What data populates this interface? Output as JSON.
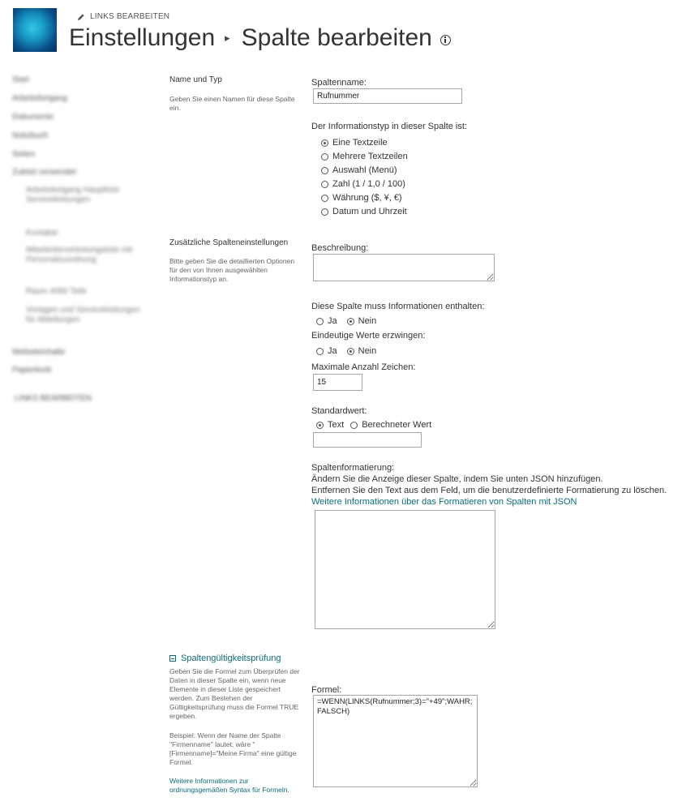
{
  "header": {
    "edit_links": "LINKS BEARBEITEN",
    "title_part1": "Einstellungen",
    "title_separator": "▸",
    "title_part2": "Spalte bearbeiten"
  },
  "nav": {
    "items": [
      "Start",
      "Arbeitsfortgang",
      "Dokumente",
      "Notizbuch",
      "Seiten",
      "Zuletzt verwendet",
      "Arbeitsfortgang Hauptliste Serviceleistungen",
      "Kontakte",
      "Mitarbeitervertretungsliste mit Personalzuordnung",
      "Raum 4050 Teile",
      "Vorlagen und Serviceleistungen für Abteilungen",
      "Websiteinhalte",
      "Papierkorb",
      "LINKS BEARBEITEN"
    ]
  },
  "section_name_type": {
    "title": "Name und Typ",
    "desc": "Geben Sie einen Namen für diese Spalte ein.",
    "column_name_label": "Spaltenname:",
    "column_name_value": "Rufnummer",
    "info_type_label": "Der Informationstyp in dieser Spalte ist:",
    "types": [
      "Eine Textzeile",
      "Mehrere Textzeilen",
      "Auswahl (Menü)",
      "Zahl (1 / 1,0 / 100)",
      "Währung ($, ¥, €)",
      "Datum und Uhrzeit"
    ],
    "selected_type": "Eine Textzeile"
  },
  "section_additional": {
    "title": "Zusätzliche Spalteneinstellungen",
    "desc": "Bitte geben Sie die detaillierten Optionen für den von Ihnen ausgewählten Informationstyp an.",
    "description_label": "Beschreibung:",
    "description_value": "",
    "required_label": "Diese Spalte muss Informationen enthalten:",
    "unique_label": "Eindeutige Werte erzwingen:",
    "yes": "Ja",
    "no": "Nein",
    "required_value": "Nein",
    "unique_value": "Nein",
    "max_chars_label": "Maximale Anzahl Zeichen:",
    "max_chars_value": "15",
    "default_label": "Standardwert:",
    "default_option_text": "Text",
    "default_option_calc": "Berechneter Wert",
    "default_selected": "Text",
    "default_value": "",
    "formatting_label": "Spaltenformatierung:",
    "formatting_line1": "Ändern Sie die Anzeige dieser Spalte, indem Sie unten JSON hinzufügen.",
    "formatting_line2": "Entfernen Sie den Text aus dem Feld, um die benutzerdefinierte Formatierung zu löschen.",
    "formatting_link": "Weitere Informationen über das Formatieren von Spalten mit JSON",
    "formatting_value": ""
  },
  "section_validation": {
    "title": "Spaltengültigkeitsprüfung",
    "desc1": "Geben Sie die Formel zum Überprüfen der Daten in dieser Spalte ein, wenn neue Elemente in dieser Liste gespeichert werden. Zum Bestehen der Gültigkeitsprüfung muss die Formel TRUE ergeben.",
    "desc2": "Beispiel: Wenn der Name der Spalte \"Firmenname\" lautet, wäre \"[Firmenname]=\"Meine Firma\" eine gültige Formel.",
    "link": "Weitere Informationen zur ordnungsgemäßen Syntax für Formeln.",
    "formula_label": "Formel:",
    "formula_value": "=WENN(LINKS(Rufnummer;3)=\"+49\";WAHR;FALSCH)"
  },
  "colors": {
    "link": "#0d6c7a",
    "text": "#333333",
    "border": "#a6a6a6"
  }
}
